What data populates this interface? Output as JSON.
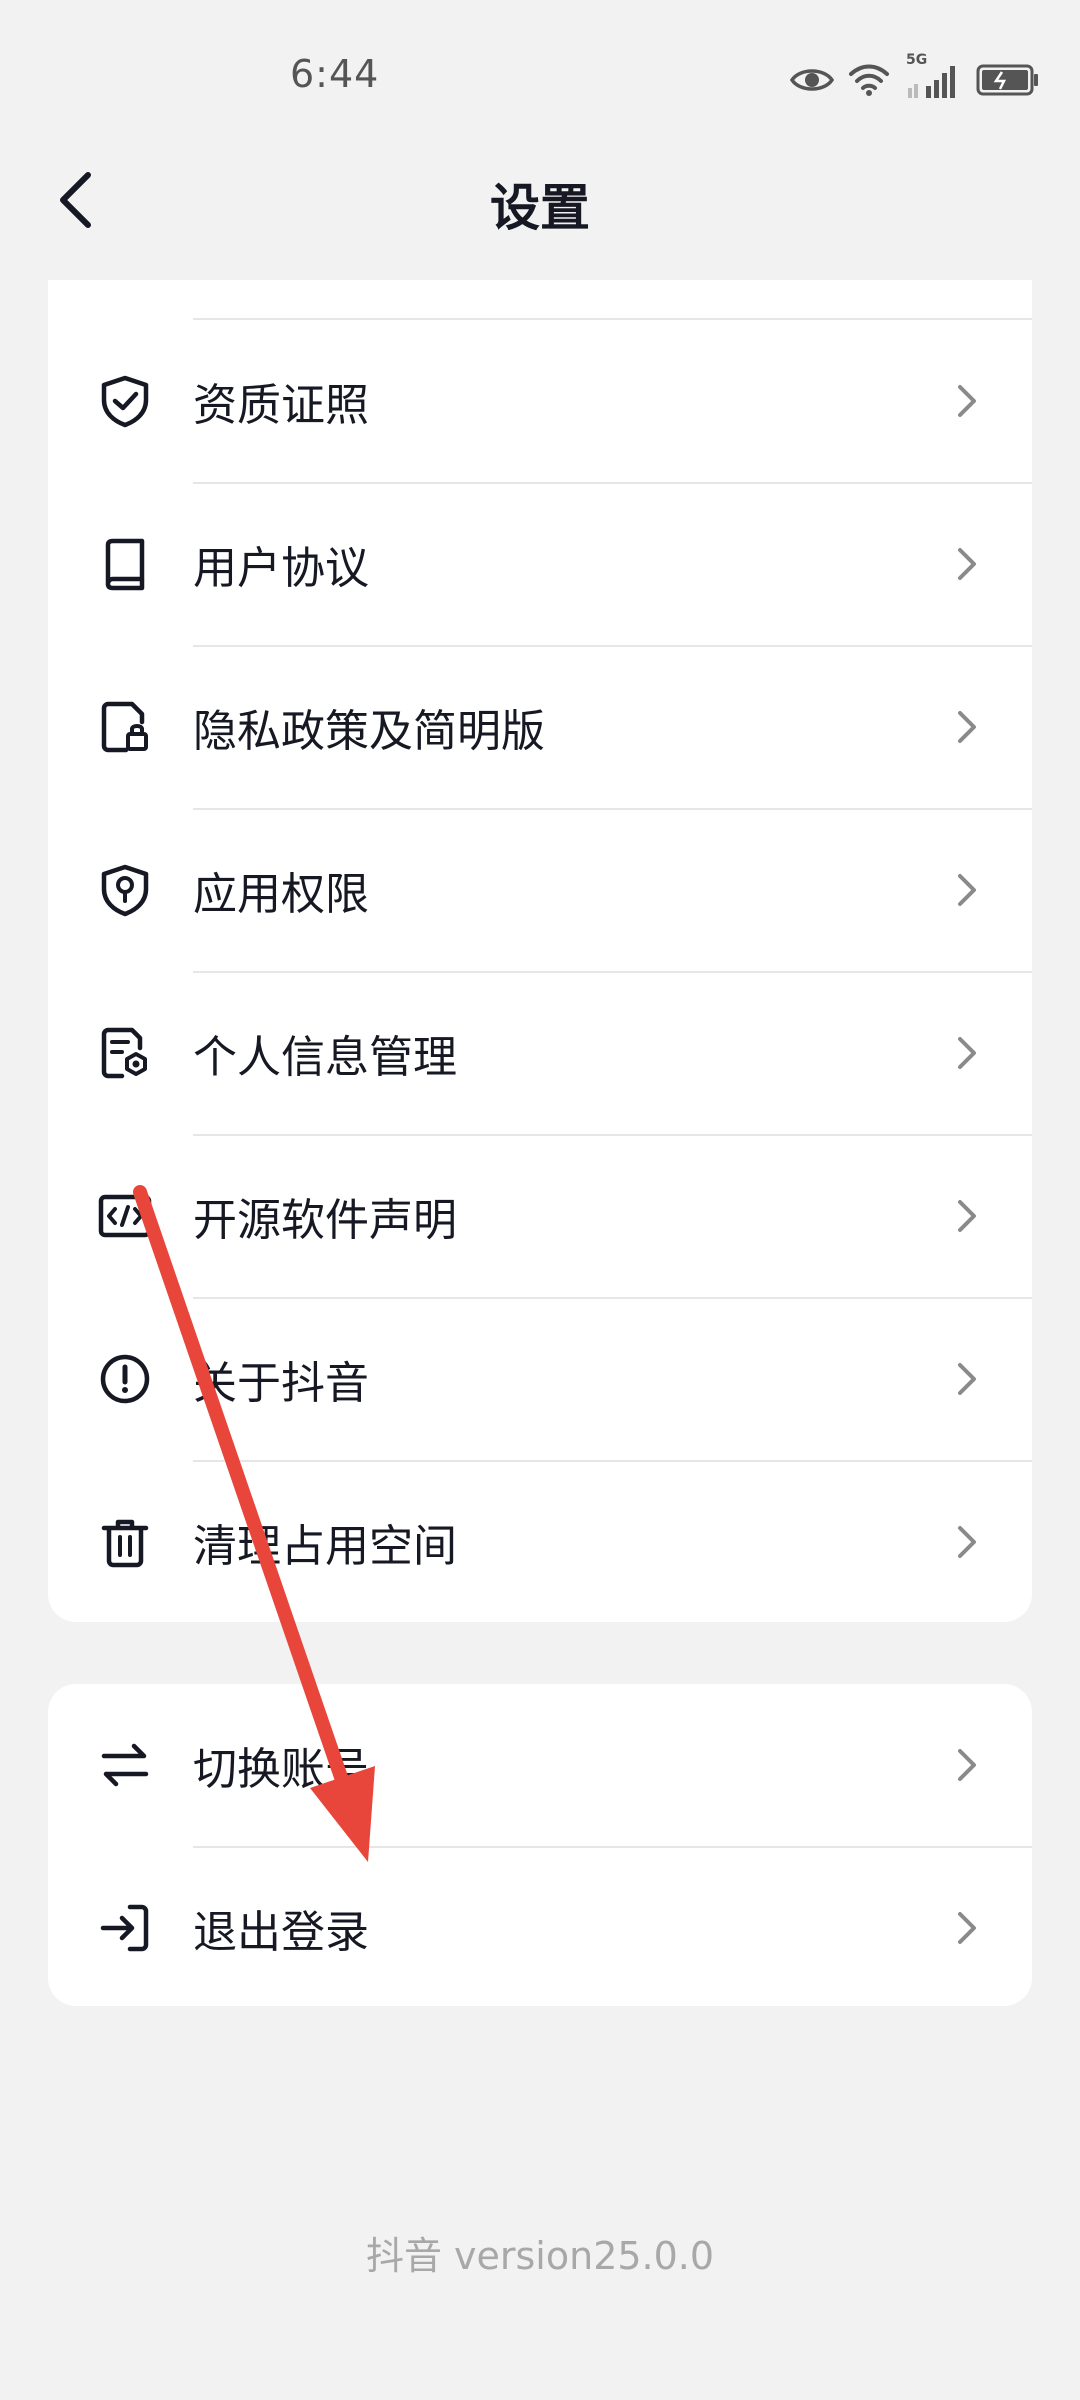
{
  "status_bar": {
    "time": "6:44",
    "network": "5G",
    "icons": [
      "eye-icon",
      "wifi-icon",
      "signal-icon",
      "battery-icon"
    ]
  },
  "header": {
    "title": "设置",
    "back_icon": "chevron-left-icon"
  },
  "settings_list": [
    {
      "label": "资质证照",
      "icon": "shield-check-icon"
    },
    {
      "label": "用户协议",
      "icon": "book-icon"
    },
    {
      "label": "隐私政策及简明版",
      "icon": "document-lock-icon"
    },
    {
      "label": "应用权限",
      "icon": "shield-key-icon"
    },
    {
      "label": "个人信息管理",
      "icon": "document-settings-icon"
    },
    {
      "label": "开源软件声明",
      "icon": "code-icon"
    },
    {
      "label": "关于抖音",
      "icon": "info-circle-icon"
    },
    {
      "label": "清理占用空间",
      "icon": "trash-icon"
    }
  ],
  "account_list": [
    {
      "label": "切换账号",
      "icon": "switch-arrows-icon"
    },
    {
      "label": "退出登录",
      "icon": "logout-icon"
    }
  ],
  "footer": {
    "version": "抖音 version25.0.0"
  },
  "colors": {
    "background": "#f2f2f2",
    "card": "#ffffff",
    "text": "#161823",
    "chevron": "#8a8a8a",
    "annotation_arrow": "#e8463a"
  }
}
